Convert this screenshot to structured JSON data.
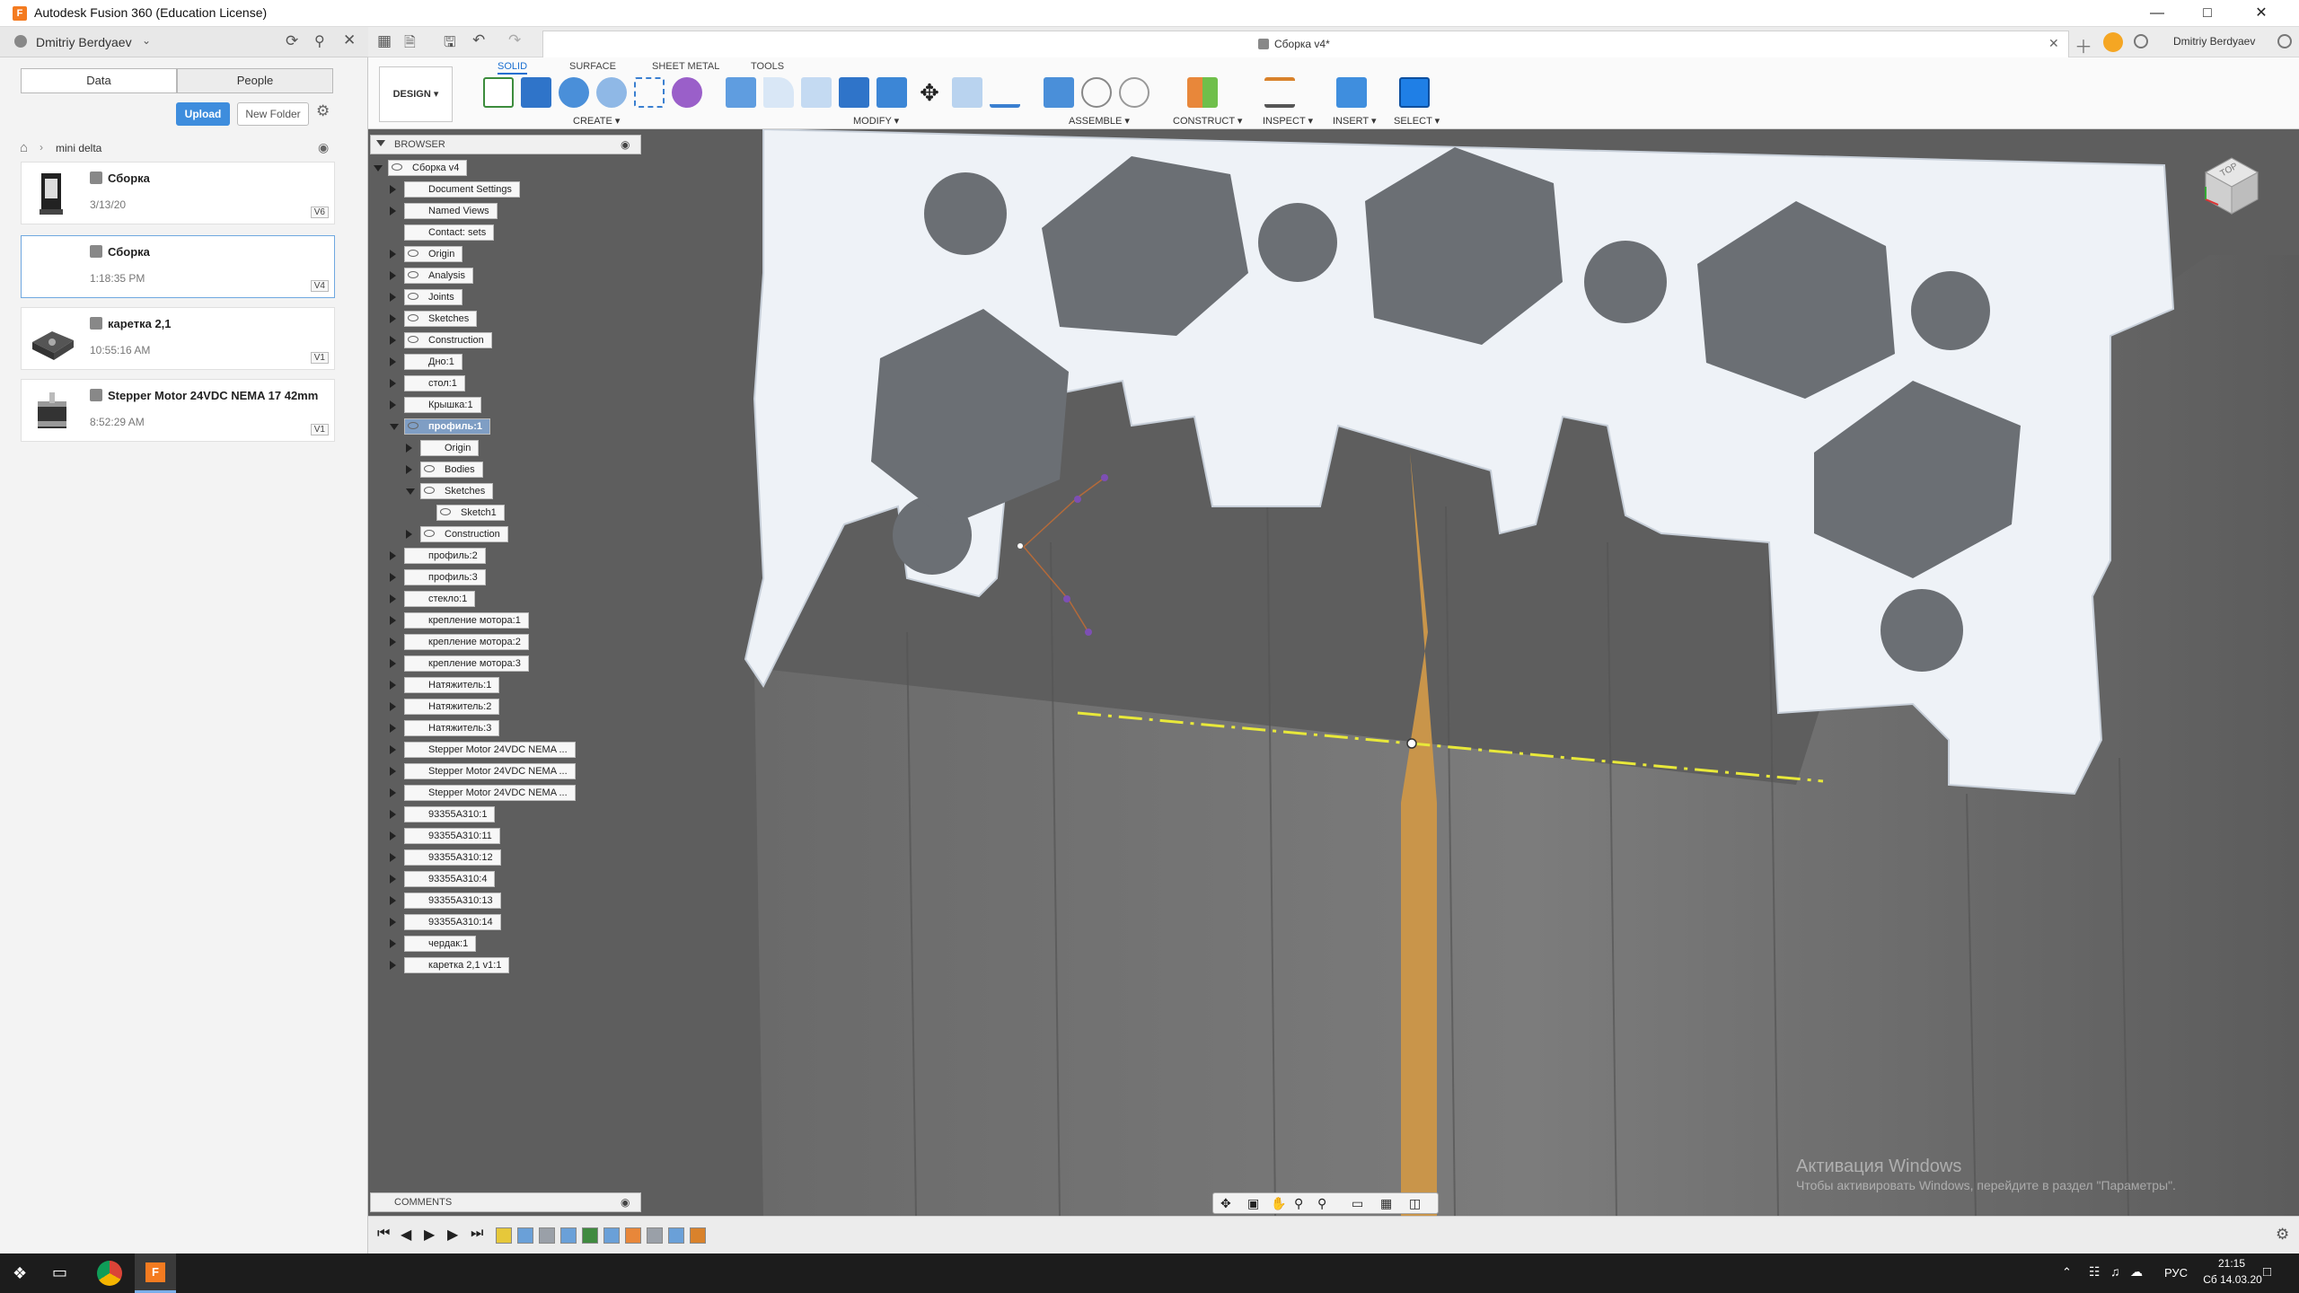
{
  "window": {
    "title": "Autodesk Fusion 360 (Education License)",
    "app_icon": "F"
  },
  "data_panel": {
    "user": "Dmitriy Berdyaev",
    "tabs": [
      "Data",
      "People"
    ],
    "upload_label": "Upload",
    "new_folder_label": "New Folder",
    "breadcrumb": "mini delta",
    "items": [
      {
        "name": "Сборка",
        "date": "3/13/20",
        "version": "V6"
      },
      {
        "name": "Сборка",
        "date": "1:18:35 PM",
        "version": "V4"
      },
      {
        "name": "каретка 2,1",
        "date": "10:55:16 AM",
        "version": "V1"
      },
      {
        "name": "Stepper Motor 24VDC NEMA 17 42mm",
        "date": "8:52:29 AM",
        "version": "V1"
      }
    ]
  },
  "document_tab": {
    "title": "Сборка v4*"
  },
  "header_user": "Dmitriy Berdyaev",
  "ribbon": {
    "workspace": "DESIGN",
    "tabs": [
      "SOLID",
      "SURFACE",
      "SHEET METAL",
      "TOOLS"
    ],
    "active_tab": "SOLID",
    "groups": [
      "CREATE",
      "MODIFY",
      "ASSEMBLE",
      "CONSTRUCT",
      "INSPECT",
      "INSERT",
      "SELECT"
    ]
  },
  "browser": {
    "title": "BROWSER",
    "comments_title": "COMMENTS",
    "nodes": [
      {
        "label": "Сборка v4",
        "depth": 0,
        "expand": "open",
        "eye": true,
        "icon": "component"
      },
      {
        "label": "Document Settings",
        "depth": 1,
        "expand": "closed",
        "eye": false,
        "icon": "gear"
      },
      {
        "label": "Named Views",
        "depth": 1,
        "expand": "closed",
        "eye": false,
        "icon": "folder"
      },
      {
        "label": "Contact: sets",
        "depth": 1,
        "expand": "none",
        "eye": false,
        "icon": "folder"
      },
      {
        "label": "Origin",
        "depth": 1,
        "expand": "closed",
        "eye": true,
        "icon": "folder"
      },
      {
        "label": "Analysis",
        "depth": 1,
        "expand": "closed",
        "eye": true,
        "icon": "folder"
      },
      {
        "label": "Joints",
        "depth": 1,
        "expand": "closed",
        "eye": true,
        "icon": "folder"
      },
      {
        "label": "Sketches",
        "depth": 1,
        "expand": "closed",
        "eye": true,
        "icon": "folder"
      },
      {
        "label": "Construction",
        "depth": 1,
        "expand": "closed",
        "eye": true,
        "icon": "folder"
      },
      {
        "label": "Дно:1",
        "depth": 1,
        "expand": "closed",
        "eye": false,
        "icon": "component"
      },
      {
        "label": "стол:1",
        "depth": 1,
        "expand": "closed",
        "eye": false,
        "icon": "component"
      },
      {
        "label": "Крышка:1",
        "depth": 1,
        "expand": "closed",
        "eye": false,
        "icon": "component"
      },
      {
        "label": "профиль:1",
        "depth": 1,
        "expand": "open",
        "eye": true,
        "icon": "component",
        "selected": true
      },
      {
        "label": "Origin",
        "depth": 2,
        "expand": "closed",
        "eye": false,
        "icon": "folder"
      },
      {
        "label": "Bodies",
        "depth": 2,
        "expand": "closed",
        "eye": true,
        "icon": "folder"
      },
      {
        "label": "Sketches",
        "depth": 2,
        "expand": "open",
        "eye": true,
        "icon": "folder"
      },
      {
        "label": "Sketch1",
        "depth": 3,
        "expand": "none",
        "eye": true,
        "icon": "sketch"
      },
      {
        "label": "Construction",
        "depth": 2,
        "expand": "closed",
        "eye": true,
        "icon": "folder"
      },
      {
        "label": "профиль:2",
        "depth": 1,
        "expand": "closed",
        "eye": false,
        "icon": "component"
      },
      {
        "label": "профиль:3",
        "depth": 1,
        "expand": "closed",
        "eye": false,
        "icon": "component"
      },
      {
        "label": "стекло:1",
        "depth": 1,
        "expand": "closed",
        "eye": false,
        "icon": "component"
      },
      {
        "label": "крепление мотора:1",
        "depth": 1,
        "expand": "closed",
        "eye": false,
        "icon": "component"
      },
      {
        "label": "крепление мотора:2",
        "depth": 1,
        "expand": "closed",
        "eye": false,
        "icon": "component"
      },
      {
        "label": "крепление мотора:3",
        "depth": 1,
        "expand": "closed",
        "eye": false,
        "icon": "component"
      },
      {
        "label": "Натяжитель:1",
        "depth": 1,
        "expand": "closed",
        "eye": false,
        "icon": "component"
      },
      {
        "label": "Натяжитель:2",
        "depth": 1,
        "expand": "closed",
        "eye": false,
        "icon": "component"
      },
      {
        "label": "Натяжитель:3",
        "depth": 1,
        "expand": "closed",
        "eye": false,
        "icon": "component"
      },
      {
        "label": "Stepper Motor 24VDC NEMA ...",
        "depth": 1,
        "expand": "closed",
        "eye": false,
        "icon": "link"
      },
      {
        "label": "Stepper Motor 24VDC NEMA ...",
        "depth": 1,
        "expand": "closed",
        "eye": false,
        "icon": "link"
      },
      {
        "label": "Stepper Motor 24VDC NEMA ...",
        "depth": 1,
        "expand": "closed",
        "eye": false,
        "icon": "link"
      },
      {
        "label": "93355A310:1",
        "depth": 1,
        "expand": "closed",
        "eye": false,
        "icon": "component"
      },
      {
        "label": "93355A310:11",
        "depth": 1,
        "expand": "closed",
        "eye": false,
        "icon": "component"
      },
      {
        "label": "93355A310:12",
        "depth": 1,
        "expand": "closed",
        "eye": false,
        "icon": "component"
      },
      {
        "label": "93355A310:4",
        "depth": 1,
        "expand": "closed",
        "eye": false,
        "icon": "component"
      },
      {
        "label": "93355A310:13",
        "depth": 1,
        "expand": "closed",
        "eye": false,
        "icon": "component"
      },
      {
        "label": "93355A310:14",
        "depth": 1,
        "expand": "closed",
        "eye": false,
        "icon": "component"
      },
      {
        "label": "чердак:1",
        "depth": 1,
        "expand": "closed",
        "eye": false,
        "icon": "component"
      },
      {
        "label": "каретка 2,1 v1:1",
        "depth": 1,
        "expand": "closed",
        "eye": false,
        "icon": "component"
      }
    ]
  },
  "viewcube": {
    "face": "TOP"
  },
  "watermark": {
    "line1": "Активация Windows",
    "line2": "Чтобы активировать Windows, перейдите в раздел \"Параметры\"."
  },
  "taskbar": {
    "lang": "РУС",
    "time": "21:15",
    "date": "Сб 14.03.20"
  },
  "colors": {
    "accent": "#3e8ddd",
    "viewport": "#5e5e5e",
    "profile": "#eef2f7",
    "sketch_plane": "#c9954a",
    "axis": "#e8e83a"
  }
}
